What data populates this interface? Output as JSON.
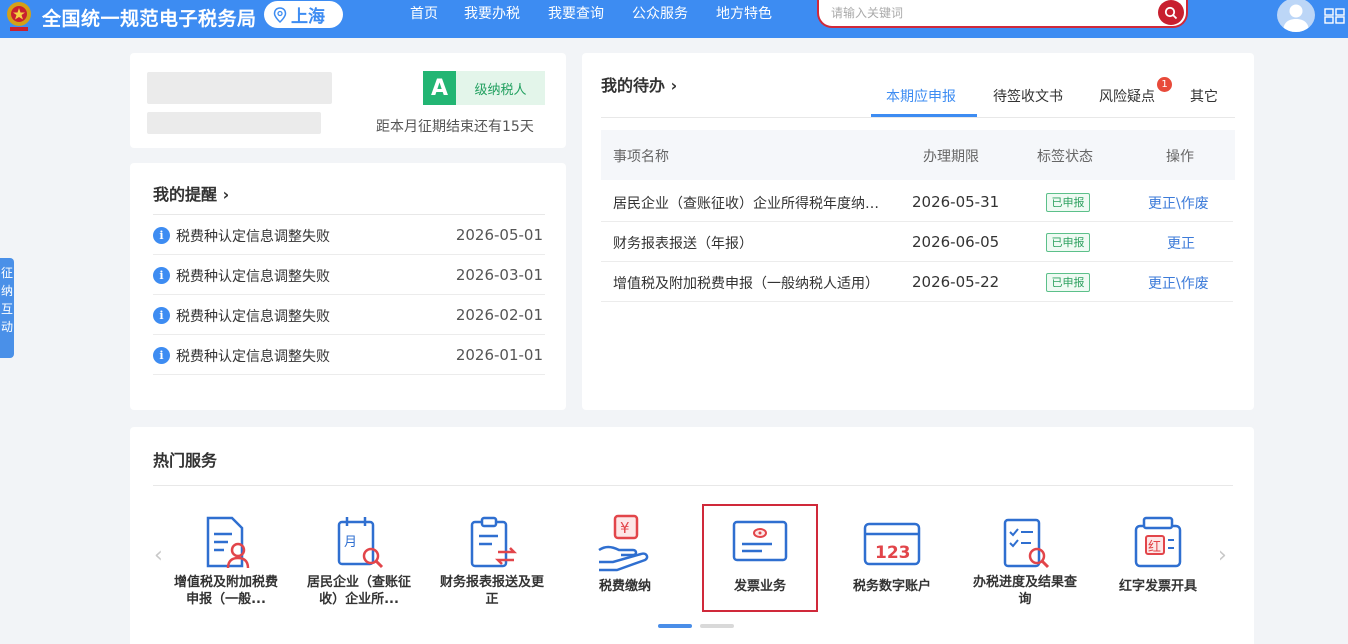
{
  "header": {
    "site_title": "全国统一规范电子税务局",
    "location": "上海",
    "nav": [
      "首页",
      "我要办税",
      "我要查询",
      "公众服务",
      "地方特色"
    ],
    "search_placeholder": "请输入关键词"
  },
  "side_float_text": "征纳互动",
  "taxpayer": {
    "rating": "A",
    "rating_label": "级纳税人",
    "countdown": "距本月征期结束还有15天"
  },
  "reminders": {
    "title": "我的提醒",
    "items": [
      {
        "text": "税费种认定信息调整失败",
        "date": "2026-05-01"
      },
      {
        "text": "税费种认定信息调整失败",
        "date": "2026-03-01"
      },
      {
        "text": "税费种认定信息调整失败",
        "date": "2026-02-01"
      },
      {
        "text": "税费种认定信息调整失败",
        "date": "2026-01-01"
      }
    ]
  },
  "todo": {
    "title": "我的待办",
    "tabs": [
      "本期应申报",
      "待签收文书",
      "风险疑点",
      "其它"
    ],
    "risk_badge": "1",
    "columns": [
      "事项名称",
      "办理期限",
      "标签状态",
      "操作"
    ],
    "rows": [
      {
        "name": "居民企业（查账征收）企业所得税年度纳税申报",
        "deadline": "2026-05-31",
        "status": "已申报",
        "op": "更正\\作废"
      },
      {
        "name": "财务报表报送（年报）",
        "deadline": "2026-06-05",
        "status": "已申报",
        "op": "更正"
      },
      {
        "name": "增值税及附加税费申报（一般纳税人适用）",
        "deadline": "2026-05-22",
        "status": "已申报",
        "op": "更正\\作废"
      }
    ]
  },
  "services": {
    "title": "热门服务",
    "items": [
      {
        "label": "增值税及附加税费申报（一般...",
        "icon": "vat-declaration-icon"
      },
      {
        "label": "居民企业（查账征收）企业所...",
        "icon": "calendar-search-icon"
      },
      {
        "label": "财务报表报送及更正",
        "icon": "report-exchange-icon"
      },
      {
        "label": "税费缴纳",
        "icon": "payment-hand-icon"
      },
      {
        "label": "发票业务",
        "icon": "invoice-icon"
      },
      {
        "label": "税务数字账户",
        "icon": "digital-account-icon"
      },
      {
        "label": "办税进度及结果查询",
        "icon": "progress-search-icon"
      },
      {
        "label": "红字发票开具",
        "icon": "red-invoice-icon"
      }
    ]
  },
  "colors": {
    "primary": "#3d8cf2",
    "highlight": "#d0293a",
    "success": "#22b573"
  }
}
